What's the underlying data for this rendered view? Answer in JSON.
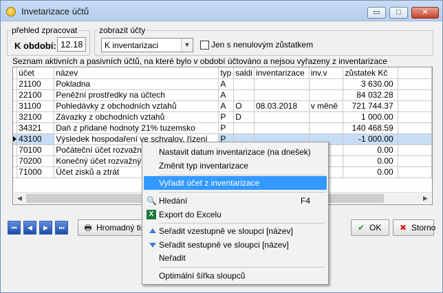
{
  "window": {
    "title": "Invetarizace účtů",
    "min_label": "▭",
    "max_label": "□",
    "close_label": "✕"
  },
  "group_period": {
    "legend": "přehled zpracovat",
    "label": "K období:",
    "value": "12.18"
  },
  "group_show": {
    "legend": "zobrazit účty",
    "combo_value": "K inventarizaci",
    "checkbox_label": "Jen s nenulovým zůstatkem"
  },
  "info_text": "Seznam aktivních a pasivních účtů, na které bylo v období účtováno a nejsou vyřazeny z inventarizace",
  "table": {
    "headers": [
      "účet",
      "název",
      "typ",
      "saldi",
      "inventarizace",
      "inv.v",
      "zůstatek Kč"
    ],
    "rows": [
      [
        "21100",
        "Pokladna",
        "A",
        "",
        "",
        "",
        "3 630.00"
      ],
      [
        "22100",
        "Peněžní prostředky na účtech",
        "A",
        "",
        "",
        "",
        "84 032.28"
      ],
      [
        "31100",
        "Pohledávky z obchodních vztahů",
        "A",
        "O",
        "08.03.2018",
        "v měně",
        "721 744.37"
      ],
      [
        "32100",
        "Závazky z obchodních vztahů",
        "P",
        "D",
        "",
        "",
        "1 000.00"
      ],
      [
        "34321",
        "Daň z přidané hodnoty 21% tuzemsko",
        "P",
        "",
        "",
        "",
        "140 468.59"
      ],
      [
        "43100",
        "Výsledek hospodaření ve schvalov. řízení",
        "P",
        "",
        "",
        "",
        "-1 000.00"
      ],
      [
        "70100",
        "Počáteční účet rozvažný",
        "",
        "",
        "",
        "",
        "0.00"
      ],
      [
        "70200",
        "Konečný účet rozvažný",
        "",
        "",
        "",
        "",
        "0.00"
      ],
      [
        "71000",
        "Účet zisků a ztrát",
        "",
        "",
        "",
        "",
        "0.00"
      ]
    ]
  },
  "bottom": {
    "nav_first": "⏮",
    "nav_prev": "◀",
    "nav_next": "▶",
    "nav_last": "⏭",
    "print_label": "Hromadný tisk",
    "ok_label": "OK",
    "cancel_label": "Storno"
  },
  "context_menu": {
    "set_date": "Nastavit datum inventarizace (na dnešek)",
    "change_type": "Změnit typ inventarizace",
    "exclude": "Vyřadit účet z inventarizace",
    "search": "Hledání",
    "search_shortcut": "F4",
    "export": "Export do Excelu",
    "sort_asc": "Seřadit vzestupně ve sloupci [název]",
    "sort_desc": "Seřadit sestupně ve sloupci [název]",
    "no_sort": "Neřadit",
    "optimal_width": "Optimální šířka sloupců"
  },
  "colors": {
    "selection": "#c6ddf5",
    "menu_highlight": "#3399ff"
  }
}
